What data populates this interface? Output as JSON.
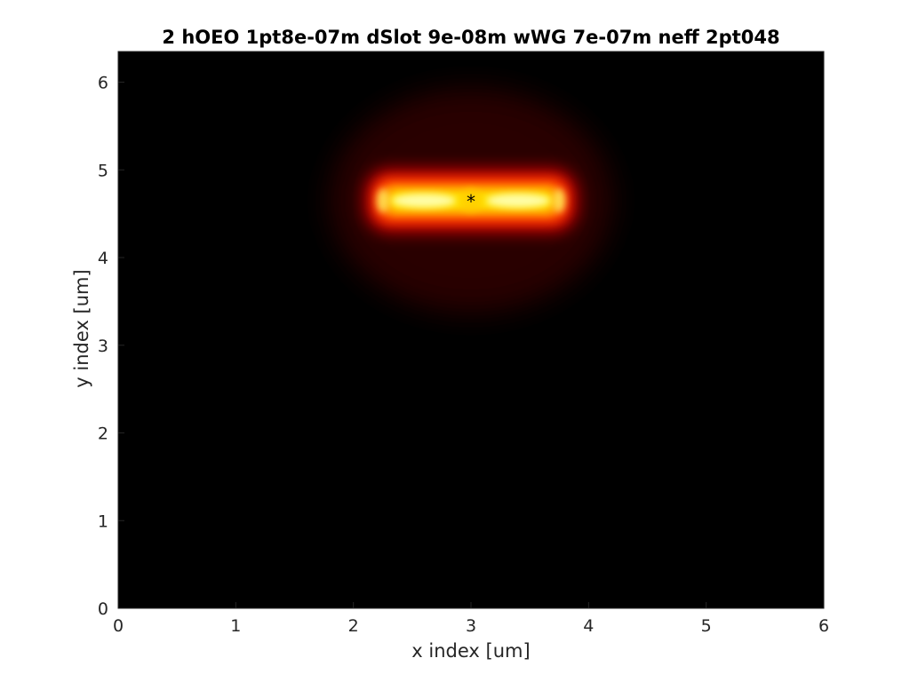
{
  "chart_data": {
    "type": "heatmap",
    "title": "2  hOEO 1pt8e-07m  dSlot 9e-08m  wWG 7e-07m neff 2pt048",
    "xlabel": "x index [um]",
    "ylabel": "y index [um]",
    "xlim": [
      0,
      6
    ],
    "ylim": [
      0,
      6.35
    ],
    "x_ticks": [
      "0",
      "1",
      "2",
      "3",
      "4",
      "5",
      "6"
    ],
    "y_ticks": [
      "0",
      "1",
      "2",
      "3",
      "4",
      "5",
      "6"
    ],
    "colormap": "hot",
    "background_color": "#000000",
    "grid": false,
    "mode_field": {
      "center_x": 3.0,
      "center_y": 4.65,
      "core_x_range": [
        2.2,
        3.8
      ],
      "core_y_range": [
        4.45,
        4.85
      ],
      "peak_lobes_x": [
        2.6,
        3.4
      ]
    },
    "marker": {
      "symbol": "*",
      "x": 3.0,
      "y": 4.65,
      "color": "#000000"
    }
  }
}
